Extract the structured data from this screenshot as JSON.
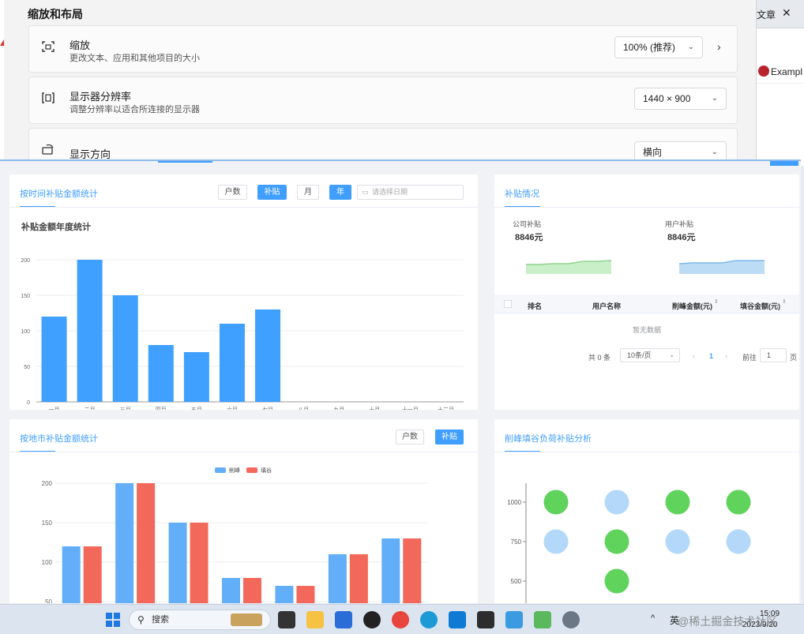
{
  "settings": {
    "title": "缩放和布局",
    "scale": {
      "name": "缩放",
      "desc": "更改文本、应用和其他项目的大小",
      "value": "100% (推荐)"
    },
    "resolution": {
      "name": "显示器分辨率",
      "desc": "调整分辨率以适合所连接的显示器",
      "value": "1440 × 900"
    },
    "orientation": {
      "name": "显示方向",
      "value": "横向"
    }
  },
  "browser": {
    "tab_title": "文章",
    "close": "✕",
    "item": "Exampl"
  },
  "time_card": {
    "title": "按时间补贴金额统计",
    "buttons": [
      "户数",
      "补贴",
      "月",
      "年"
    ],
    "date_placeholder": "请选择日期",
    "chart_title": "补贴金额年度统计"
  },
  "city_card": {
    "title": "按地市补贴金额统计",
    "buttons": [
      "户数",
      "补贴"
    ]
  },
  "subsidy_card": {
    "title": "补贴情况",
    "company_label": "公司补贴",
    "company_value": "8846元",
    "user_label": "用户补贴",
    "user_value": "8846元",
    "columns": [
      "排名",
      "用户名称",
      "削峰金额(元)",
      "填谷金额(元)"
    ],
    "empty": "暂无数据",
    "pager": {
      "total": "共 0 条",
      "size": "10条/页",
      "page": "1",
      "goto": "前往",
      "goto_val": "1",
      "unit": "页"
    }
  },
  "peak_card": {
    "title": "削峰填谷负荷补贴分析"
  },
  "chart_data": [
    {
      "type": "bar",
      "title": "补贴金额年度统计",
      "categories": [
        "一月",
        "二月",
        "三月",
        "四月",
        "五月",
        "六月",
        "七月",
        "八月",
        "九月",
        "十月",
        "十一月",
        "十二月"
      ],
      "values": [
        120,
        200,
        150,
        80,
        70,
        110,
        130,
        null,
        null,
        null,
        null,
        null
      ],
      "ylim": [
        0,
        200
      ],
      "yticks": [
        0,
        50,
        100,
        150,
        200
      ],
      "color": "#3fa0ff"
    },
    {
      "type": "bar",
      "legend": [
        "削峰",
        "填谷"
      ],
      "series": [
        {
          "name": "削峰",
          "values": [
            120,
            200,
            150,
            80,
            70,
            110,
            130
          ],
          "color": "#62aef8"
        },
        {
          "name": "填谷",
          "values": [
            120,
            200,
            150,
            80,
            70,
            110,
            130
          ],
          "color": "#f2685a"
        }
      ],
      "yticks": [
        50,
        100,
        150,
        200
      ]
    },
    {
      "type": "scatter",
      "yticks": [
        500,
        750,
        1000
      ],
      "points": [
        {
          "col": 1,
          "y": 1000,
          "color": "green"
        },
        {
          "col": 2,
          "y": 1000,
          "color": "blue"
        },
        {
          "col": 3,
          "y": 1000,
          "color": "green"
        },
        {
          "col": 4,
          "y": 1000,
          "color": "green"
        },
        {
          "col": 1,
          "y": 750,
          "color": "blue"
        },
        {
          "col": 2,
          "y": 750,
          "color": "green"
        },
        {
          "col": 3,
          "y": 750,
          "color": "blue"
        },
        {
          "col": 4,
          "y": 750,
          "color": "blue"
        },
        {
          "col": 2,
          "y": 500,
          "color": "green"
        }
      ]
    }
  ],
  "taskbar": {
    "search": "搜索",
    "ime": "英",
    "time": "15:09",
    "date": "2023/9/20"
  },
  "watermark": "@稀土掘金技术社区"
}
